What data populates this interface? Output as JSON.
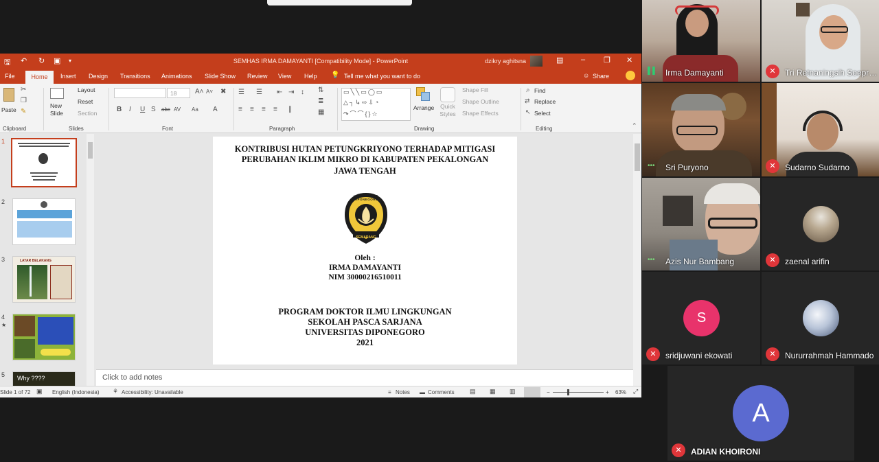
{
  "powerpoint": {
    "doc_title": "SEMHAS IRMA DAMAYANTI [Compatibility Mode]  -  PowerPoint",
    "user_name": "dzikry aghitsna",
    "tabs": [
      "File",
      "Home",
      "Insert",
      "Design",
      "Transitions",
      "Animations",
      "Slide Show",
      "Review",
      "View",
      "Help"
    ],
    "tell_me": "Tell me what you want to do",
    "share": "Share",
    "ribbon": {
      "paste": "Paste",
      "clipboard": "Clipboard",
      "new_slide": "New Slide",
      "layout": "Layout",
      "reset": "Reset",
      "section": "Section",
      "slides": "Slides",
      "font_size": "18",
      "font": "Font",
      "paragraph": "Paragraph",
      "arrange": "Arrange",
      "quick_styles": "Quick Styles",
      "shape_fill": "Shape Fill",
      "shape_outline": "Shape Outline",
      "shape_effects": "Shape Effects",
      "drawing": "Drawing",
      "find": "Find",
      "replace": "Replace",
      "select": "Select",
      "editing": "Editing"
    },
    "thumbnails": [
      {
        "num": "1",
        "selected": true
      },
      {
        "num": "2",
        "selected": false
      },
      {
        "num": "3",
        "selected": false,
        "caption": "LATAR BELAKANG"
      },
      {
        "num": "4",
        "selected": false
      },
      {
        "num": "5",
        "selected": false,
        "caption": "Why ????"
      }
    ],
    "slide": {
      "title_line1": "KONTRIBUSI HUTAN PETUNGKRIYONO TERHADAP MITIGASI",
      "title_line2": "PERUBAHAN IKLIM MIKRO DI KABUPATEN PEKALONGAN",
      "title_line3": "JAWA TENGAH",
      "logo_top": "UNIVERSITAS DIPONEGORO",
      "logo_bottom": "SEMARANG",
      "oleh": "Oleh :",
      "author": "IRMA DAMAYANTI",
      "nim": "NIM 30000216510011",
      "program1": "PROGRAM DOKTOR ILMU LINGKUNGAN",
      "program2": "SEKOLAH PASCA SARJANA",
      "program3": "UNIVERSITAS DIPONEGORO",
      "year": "2021"
    },
    "notes_placeholder": "Click to add notes",
    "status": {
      "slide_count": "Slide 1 of 72",
      "language": "English (Indonesia)",
      "accessibility": "Accessibility: Unavailable",
      "notes": "Notes",
      "comments": "Comments",
      "zoom": "63%"
    }
  },
  "participants": [
    {
      "name": "Irma Damayanti",
      "muted": false,
      "talking": true
    },
    {
      "name": "Tri Retnaningsih Soepro...",
      "muted": true
    },
    {
      "name": "Sri Puryono",
      "muted": false
    },
    {
      "name": "Sudarno Sudarno",
      "muted": true
    },
    {
      "name": "Azis Nur Bambang",
      "muted": false
    },
    {
      "name": "zaenal arifin",
      "muted": true
    },
    {
      "name": "sridjuwani ekowati",
      "muted": true,
      "letter": "S",
      "color": "#e8336b"
    },
    {
      "name": "Nururrahmah Hammado",
      "muted": true
    },
    {
      "name": "ADIAN KHOIRONI",
      "muted": true,
      "letter": "A",
      "color": "#5b6ad0"
    }
  ],
  "colors": {
    "ppt_accent": "#c43e1c",
    "mic_muted": "#e0363a",
    "speaking": "#2ecc71"
  }
}
